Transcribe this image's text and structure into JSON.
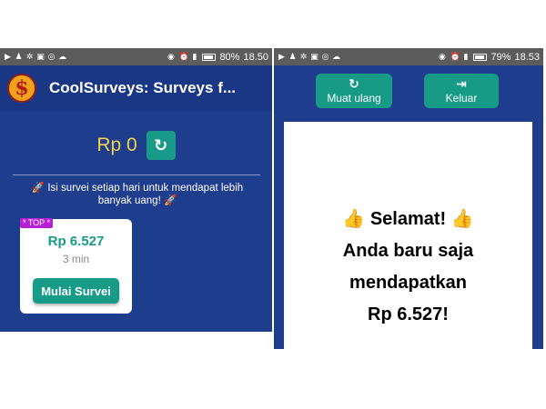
{
  "left": {
    "status": {
      "battery": "80%",
      "time": "18.50"
    },
    "app_title": "CoolSurveys: Surveys f...",
    "logo_symbol": "$",
    "balance": "Rp 0",
    "refresh_icon": "↻",
    "promo_text": "🚀 Isi survei setiap hari untuk mendapat lebih banyak uang! 🚀",
    "survey_card": {
      "badge": "* TOP *",
      "amount": "Rp 6.527",
      "duration": "3 min",
      "button_label": "Mulai Survei"
    }
  },
  "right": {
    "status": {
      "battery": "79%",
      "time": "18.53"
    },
    "reload_button": {
      "icon": "↻",
      "label": "Muat ulang"
    },
    "exit_button": {
      "icon": "⇥",
      "label": "Keluar"
    },
    "result": {
      "line1": "Selamat!",
      "line2": "Anda baru saja",
      "line3": "mendapatkan",
      "line4": "Rp 6.527!"
    }
  },
  "colors": {
    "primary_blue": "#1e3d8c",
    "teal": "#179b87",
    "gold": "#f3d24a",
    "badge_purple": "#b621d6"
  }
}
